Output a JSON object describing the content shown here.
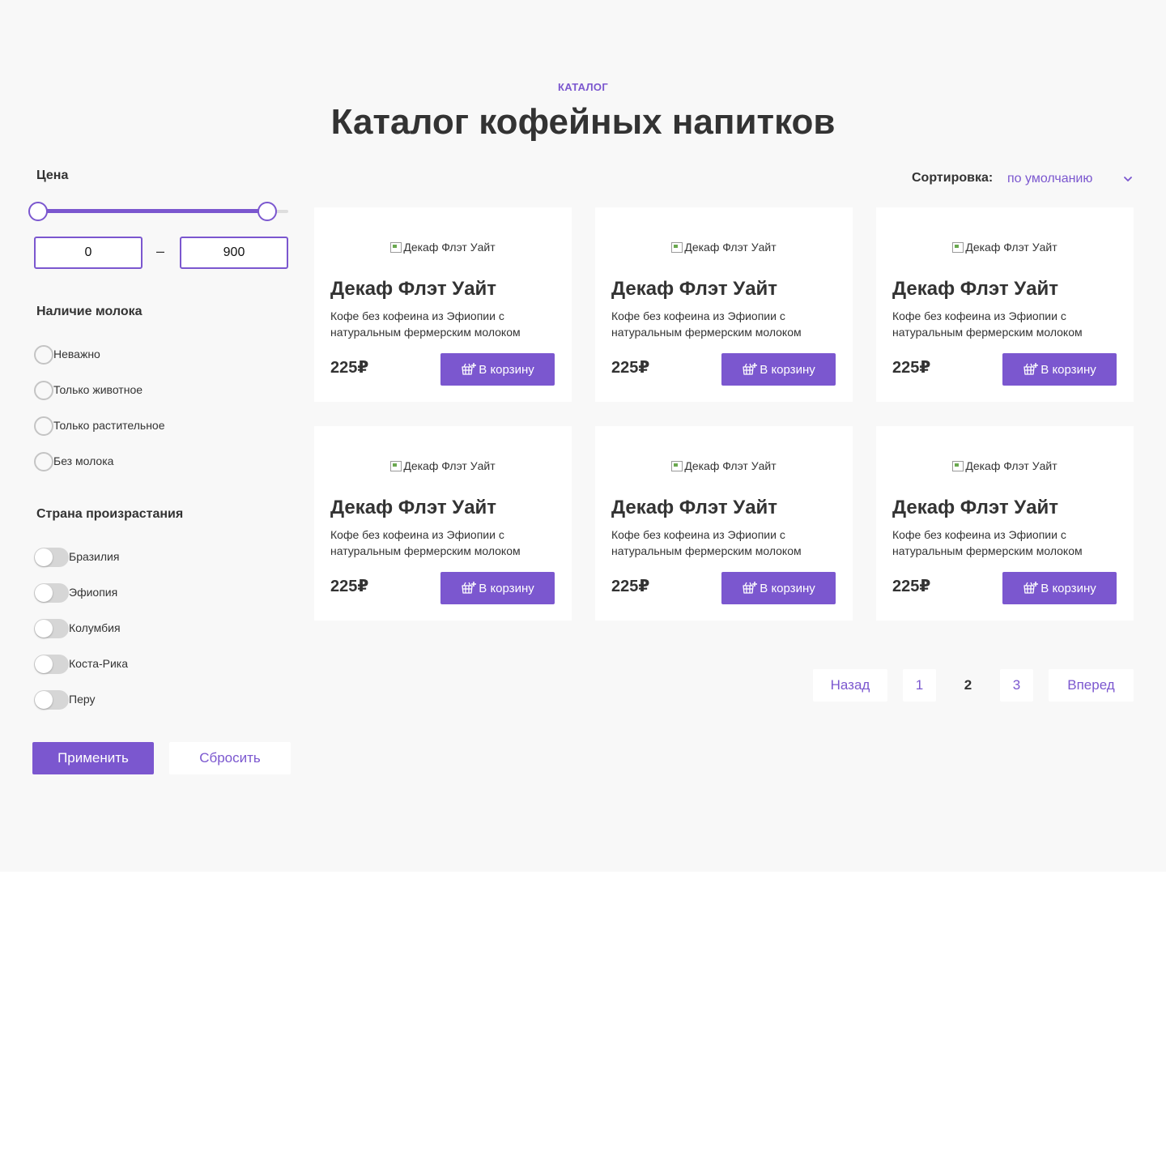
{
  "header": {
    "eyebrow": "КАТАЛОГ",
    "title": "Каталог кофейных напитков"
  },
  "filters": {
    "price": {
      "heading": "Цена",
      "min_value": "0",
      "max_value": "900",
      "dash": "–",
      "range_low_fraction": 0,
      "range_high_fraction": 0.88
    },
    "milk": {
      "heading": "Наличие молока",
      "options": [
        "Неважно",
        "Только животное",
        "Только растительное",
        "Без молока"
      ]
    },
    "country": {
      "heading": "Страна произрастания",
      "options": [
        "Бразилия",
        "Эфиопия",
        "Колумбия",
        "Коста-Рика",
        "Перу"
      ]
    },
    "apply_label": "Применить",
    "reset_label": "Сбросить"
  },
  "sort": {
    "label": "Сортировка:",
    "value": "по умолчанию"
  },
  "products": [
    {
      "image_alt": "Декаф Флэт Уайт",
      "title": "Декаф Флэт Уайт",
      "description": "Кофе без кофеина из Эфиопии с натуральным фермерским молоком",
      "price": "225₽",
      "button": "В корзину"
    },
    {
      "image_alt": "Декаф Флэт Уайт",
      "title": "Декаф Флэт Уайт",
      "description": "Кофе без кофеина из Эфиопии с натуральным фермерским молоком",
      "price": "225₽",
      "button": "В корзину"
    },
    {
      "image_alt": "Декаф Флэт Уайт",
      "title": "Декаф Флэт Уайт",
      "description": "Кофе без кофеина из Эфиопии с натуральным фермерским молоком",
      "price": "225₽",
      "button": "В корзину"
    },
    {
      "image_alt": "Декаф Флэт Уайт",
      "title": "Декаф Флэт Уайт",
      "description": "Кофе без кофеина из Эфиопии с натуральным фермерским молоком",
      "price": "225₽",
      "button": "В корзину"
    },
    {
      "image_alt": "Декаф Флэт Уайт",
      "title": "Декаф Флэт Уайт",
      "description": "Кофе без кофеина из Эфиопии с натуральным фермерским молоком",
      "price": "225₽",
      "button": "В корзину"
    },
    {
      "image_alt": "Декаф Флэт Уайт",
      "title": "Декаф Флэт Уайт",
      "description": "Кофе без кофеина из Эфиопии с натуральным фермерским молоком",
      "price": "225₽",
      "button": "В корзину"
    }
  ],
  "pagination": {
    "prev": "Назад",
    "pages": [
      "1",
      "2",
      "3"
    ],
    "current": "2",
    "next": "Вперед"
  },
  "colors": {
    "accent": "#7b57cf",
    "text": "#333333",
    "background": "#f8f8f8"
  },
  "icons": {
    "cart": "cart-plus-icon",
    "sort_chevron": "chevron-down-icon",
    "image_placeholder": "broken-image-icon"
  }
}
